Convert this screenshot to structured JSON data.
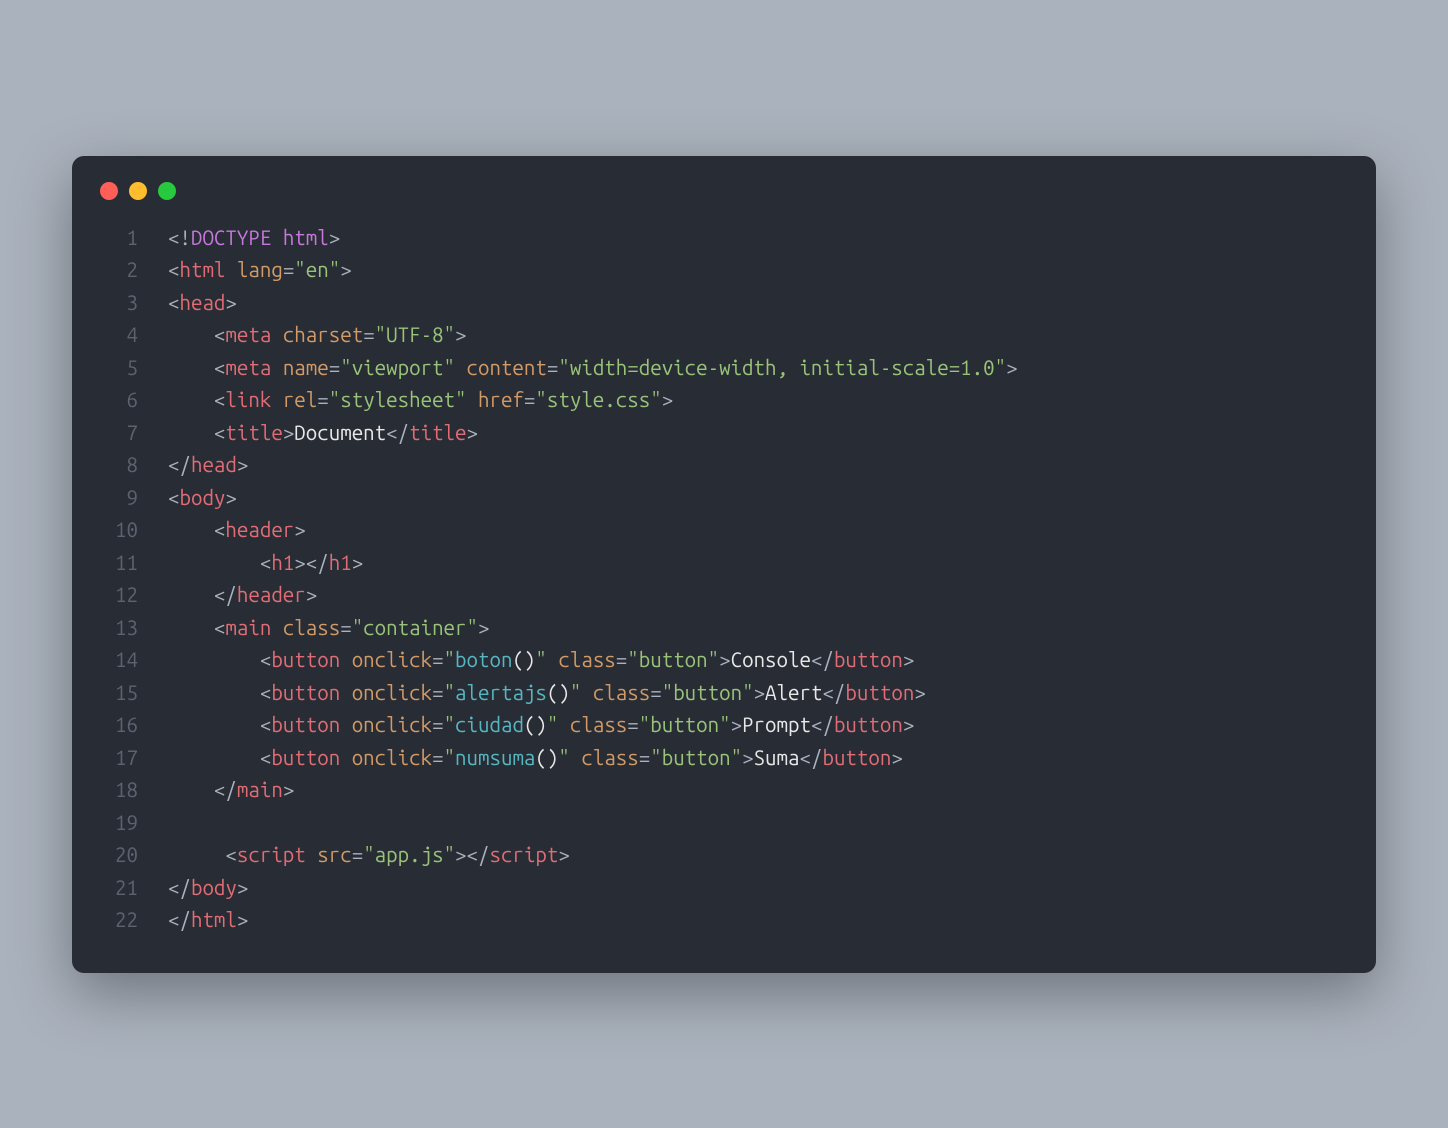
{
  "window": {
    "traffic_lights": [
      "close",
      "minimize",
      "zoom"
    ]
  },
  "editor": {
    "line_numbers": [
      "1",
      "2",
      "3",
      "4",
      "5",
      "6",
      "7",
      "8",
      "9",
      "10",
      "11",
      "12",
      "13",
      "14",
      "15",
      "16",
      "17",
      "18",
      "19",
      "20",
      "21",
      "22"
    ],
    "lines": [
      {
        "indent": 0,
        "tokens": [
          {
            "t": "<!",
            "c": "p"
          },
          {
            "t": "DOCTYPE",
            "c": "dt"
          },
          {
            "t": " ",
            "c": "p"
          },
          {
            "t": "html",
            "c": "dt"
          },
          {
            "t": ">",
            "c": "p"
          }
        ]
      },
      {
        "indent": 0,
        "tokens": [
          {
            "t": "<",
            "c": "p"
          },
          {
            "t": "html",
            "c": "r"
          },
          {
            "t": " ",
            "c": "p"
          },
          {
            "t": "lang",
            "c": "o"
          },
          {
            "t": "=",
            "c": "p"
          },
          {
            "t": "\"en\"",
            "c": "g"
          },
          {
            "t": ">",
            "c": "p"
          }
        ]
      },
      {
        "indent": 0,
        "tokens": [
          {
            "t": "<",
            "c": "p"
          },
          {
            "t": "head",
            "c": "r"
          },
          {
            "t": ">",
            "c": "p"
          }
        ]
      },
      {
        "indent": 1,
        "tokens": [
          {
            "t": "<",
            "c": "p"
          },
          {
            "t": "meta",
            "c": "r"
          },
          {
            "t": " ",
            "c": "p"
          },
          {
            "t": "charset",
            "c": "o"
          },
          {
            "t": "=",
            "c": "p"
          },
          {
            "t": "\"UTF-8\"",
            "c": "g"
          },
          {
            "t": ">",
            "c": "p"
          }
        ]
      },
      {
        "indent": 1,
        "tokens": [
          {
            "t": "<",
            "c": "p"
          },
          {
            "t": "meta",
            "c": "r"
          },
          {
            "t": " ",
            "c": "p"
          },
          {
            "t": "name",
            "c": "o"
          },
          {
            "t": "=",
            "c": "p"
          },
          {
            "t": "\"viewport\"",
            "c": "g"
          },
          {
            "t": " ",
            "c": "p"
          },
          {
            "t": "content",
            "c": "o"
          },
          {
            "t": "=",
            "c": "p"
          },
          {
            "t": "\"width=device-width, initial-scale=1.0\"",
            "c": "g"
          },
          {
            "t": ">",
            "c": "p"
          }
        ]
      },
      {
        "indent": 1,
        "tokens": [
          {
            "t": "<",
            "c": "p"
          },
          {
            "t": "link",
            "c": "r"
          },
          {
            "t": " ",
            "c": "p"
          },
          {
            "t": "rel",
            "c": "o"
          },
          {
            "t": "=",
            "c": "p"
          },
          {
            "t": "\"stylesheet\"",
            "c": "g"
          },
          {
            "t": " ",
            "c": "p"
          },
          {
            "t": "href",
            "c": "o"
          },
          {
            "t": "=",
            "c": "p"
          },
          {
            "t": "\"style.css\"",
            "c": "g"
          },
          {
            "t": ">",
            "c": "p"
          }
        ]
      },
      {
        "indent": 1,
        "tokens": [
          {
            "t": "<",
            "c": "p"
          },
          {
            "t": "title",
            "c": "r"
          },
          {
            "t": ">",
            "c": "p"
          },
          {
            "t": "Document",
            "c": "w"
          },
          {
            "t": "</",
            "c": "p"
          },
          {
            "t": "title",
            "c": "r"
          },
          {
            "t": ">",
            "c": "p"
          }
        ]
      },
      {
        "indent": 0,
        "tokens": [
          {
            "t": "</",
            "c": "p"
          },
          {
            "t": "head",
            "c": "r"
          },
          {
            "t": ">",
            "c": "p"
          }
        ]
      },
      {
        "indent": 0,
        "tokens": [
          {
            "t": "<",
            "c": "p"
          },
          {
            "t": "body",
            "c": "r"
          },
          {
            "t": ">",
            "c": "p"
          }
        ]
      },
      {
        "indent": 1,
        "tokens": [
          {
            "t": "<",
            "c": "p"
          },
          {
            "t": "header",
            "c": "r"
          },
          {
            "t": ">",
            "c": "p"
          }
        ]
      },
      {
        "indent": 2,
        "tokens": [
          {
            "t": "<",
            "c": "p"
          },
          {
            "t": "h1",
            "c": "r"
          },
          {
            "t": "></",
            "c": "p"
          },
          {
            "t": "h1",
            "c": "r"
          },
          {
            "t": ">",
            "c": "p"
          }
        ]
      },
      {
        "indent": 1,
        "tokens": [
          {
            "t": "</",
            "c": "p"
          },
          {
            "t": "header",
            "c": "r"
          },
          {
            "t": ">",
            "c": "p"
          }
        ]
      },
      {
        "indent": 1,
        "tokens": [
          {
            "t": "<",
            "c": "p"
          },
          {
            "t": "main",
            "c": "r"
          },
          {
            "t": " ",
            "c": "p"
          },
          {
            "t": "class",
            "c": "o"
          },
          {
            "t": "=",
            "c": "p"
          },
          {
            "t": "\"container\"",
            "c": "g"
          },
          {
            "t": ">",
            "c": "p"
          }
        ]
      },
      {
        "indent": 2,
        "tokens": [
          {
            "t": "<",
            "c": "p"
          },
          {
            "t": "button",
            "c": "r"
          },
          {
            "t": " ",
            "c": "p"
          },
          {
            "t": "onclick",
            "c": "o"
          },
          {
            "t": "=",
            "c": "p"
          },
          {
            "t": "\"",
            "c": "g"
          },
          {
            "t": "boton",
            "c": "c"
          },
          {
            "t": "()",
            "c": "w"
          },
          {
            "t": "\"",
            "c": "g"
          },
          {
            "t": " ",
            "c": "p"
          },
          {
            "t": "class",
            "c": "o"
          },
          {
            "t": "=",
            "c": "p"
          },
          {
            "t": "\"button\"",
            "c": "g"
          },
          {
            "t": ">",
            "c": "p"
          },
          {
            "t": "Console",
            "c": "w"
          },
          {
            "t": "</",
            "c": "p"
          },
          {
            "t": "button",
            "c": "r"
          },
          {
            "t": ">",
            "c": "p"
          }
        ]
      },
      {
        "indent": 2,
        "tokens": [
          {
            "t": "<",
            "c": "p"
          },
          {
            "t": "button",
            "c": "r"
          },
          {
            "t": " ",
            "c": "p"
          },
          {
            "t": "onclick",
            "c": "o"
          },
          {
            "t": "=",
            "c": "p"
          },
          {
            "t": "\"",
            "c": "g"
          },
          {
            "t": "alertajs",
            "c": "c"
          },
          {
            "t": "()",
            "c": "w"
          },
          {
            "t": "\"",
            "c": "g"
          },
          {
            "t": " ",
            "c": "p"
          },
          {
            "t": "class",
            "c": "o"
          },
          {
            "t": "=",
            "c": "p"
          },
          {
            "t": "\"button\"",
            "c": "g"
          },
          {
            "t": ">",
            "c": "p"
          },
          {
            "t": "Alert",
            "c": "w"
          },
          {
            "t": "</",
            "c": "p"
          },
          {
            "t": "button",
            "c": "r"
          },
          {
            "t": ">",
            "c": "p"
          }
        ]
      },
      {
        "indent": 2,
        "tokens": [
          {
            "t": "<",
            "c": "p"
          },
          {
            "t": "button",
            "c": "r"
          },
          {
            "t": " ",
            "c": "p"
          },
          {
            "t": "onclick",
            "c": "o"
          },
          {
            "t": "=",
            "c": "p"
          },
          {
            "t": "\"",
            "c": "g"
          },
          {
            "t": "ciudad",
            "c": "c"
          },
          {
            "t": "()",
            "c": "w"
          },
          {
            "t": "\"",
            "c": "g"
          },
          {
            "t": " ",
            "c": "p"
          },
          {
            "t": "class",
            "c": "o"
          },
          {
            "t": "=",
            "c": "p"
          },
          {
            "t": "\"button\"",
            "c": "g"
          },
          {
            "t": ">",
            "c": "p"
          },
          {
            "t": "Prompt",
            "c": "w"
          },
          {
            "t": "</",
            "c": "p"
          },
          {
            "t": "button",
            "c": "r"
          },
          {
            "t": ">",
            "c": "p"
          }
        ]
      },
      {
        "indent": 2,
        "tokens": [
          {
            "t": "<",
            "c": "p"
          },
          {
            "t": "button",
            "c": "r"
          },
          {
            "t": " ",
            "c": "p"
          },
          {
            "t": "onclick",
            "c": "o"
          },
          {
            "t": "=",
            "c": "p"
          },
          {
            "t": "\"",
            "c": "g"
          },
          {
            "t": "numsuma",
            "c": "c"
          },
          {
            "t": "()",
            "c": "w"
          },
          {
            "t": "\"",
            "c": "g"
          },
          {
            "t": " ",
            "c": "p"
          },
          {
            "t": "class",
            "c": "o"
          },
          {
            "t": "=",
            "c": "p"
          },
          {
            "t": "\"button\"",
            "c": "g"
          },
          {
            "t": ">",
            "c": "p"
          },
          {
            "t": "Suma",
            "c": "w"
          },
          {
            "t": "</",
            "c": "p"
          },
          {
            "t": "button",
            "c": "r"
          },
          {
            "t": ">",
            "c": "p"
          }
        ]
      },
      {
        "indent": 1,
        "tokens": [
          {
            "t": "</",
            "c": "p"
          },
          {
            "t": "main",
            "c": "r"
          },
          {
            "t": ">",
            "c": "p"
          }
        ]
      },
      {
        "indent": 0,
        "tokens": []
      },
      {
        "indent": 1,
        "tokens": [
          {
            "t": " ",
            "c": "p"
          },
          {
            "t": "<",
            "c": "p"
          },
          {
            "t": "script",
            "c": "r"
          },
          {
            "t": " ",
            "c": "p"
          },
          {
            "t": "src",
            "c": "o"
          },
          {
            "t": "=",
            "c": "p"
          },
          {
            "t": "\"app.js\"",
            "c": "g"
          },
          {
            "t": "></",
            "c": "p"
          },
          {
            "t": "script",
            "c": "r"
          },
          {
            "t": ">",
            "c": "p"
          }
        ]
      },
      {
        "indent": 0,
        "tokens": [
          {
            "t": "</",
            "c": "p"
          },
          {
            "t": "body",
            "c": "r"
          },
          {
            "t": ">",
            "c": "p"
          }
        ]
      },
      {
        "indent": 0,
        "tokens": [
          {
            "t": "</",
            "c": "p"
          },
          {
            "t": "html",
            "c": "r"
          },
          {
            "t": ">",
            "c": "p"
          }
        ]
      }
    ]
  }
}
